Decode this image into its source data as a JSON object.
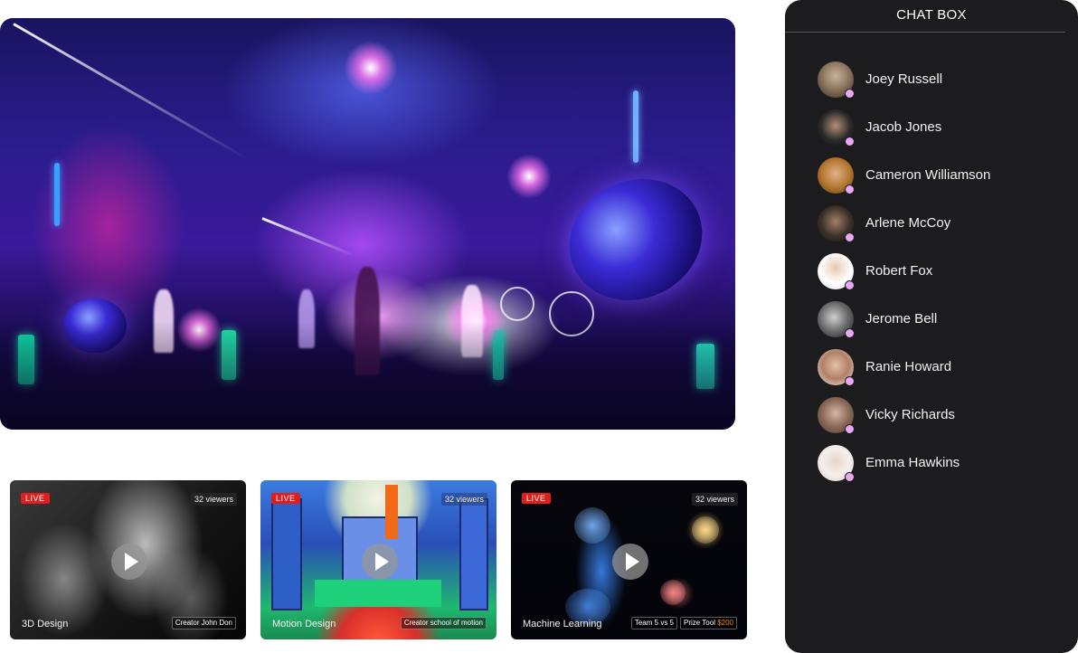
{
  "featured": {
    "image": "neon cyberpunk city street scene"
  },
  "streams": [
    {
      "live": "LIVE",
      "viewers": "32 viewers",
      "title": "3D Design",
      "tags": [
        {
          "text": "Creator  John Don",
          "accent": ""
        }
      ]
    },
    {
      "live": "LIVE",
      "viewers": "32 viewers",
      "title": "Motion Design",
      "tags": [
        {
          "text": "Creator  school of motion",
          "accent": ""
        }
      ]
    },
    {
      "live": "LIVE",
      "viewers": "32 viewers",
      "title": "Machine Learning",
      "tags": [
        {
          "text": "Team  5 vs 5",
          "accent": ""
        },
        {
          "text": "Prize Tool ",
          "accent": "$200"
        }
      ]
    }
  ],
  "chat": {
    "title": "CHAT BOX",
    "users": [
      {
        "name": "Joey Russell"
      },
      {
        "name": "Jacob Jones"
      },
      {
        "name": "Cameron Williamson"
      },
      {
        "name": "Arlene McCoy"
      },
      {
        "name": "Robert Fox"
      },
      {
        "name": "Jerome Bell"
      },
      {
        "name": "Ranie Howard"
      },
      {
        "name": "Vicky Richards"
      },
      {
        "name": "Emma Hawkins"
      }
    ]
  },
  "colors": {
    "live_badge": "#e01e1e",
    "online_dot": "#e9a9f2",
    "chat_bg": "#1c1c1f",
    "prize_accent": "#f08a1a"
  },
  "icons": [
    "play-icon",
    "online-status-icon"
  ]
}
